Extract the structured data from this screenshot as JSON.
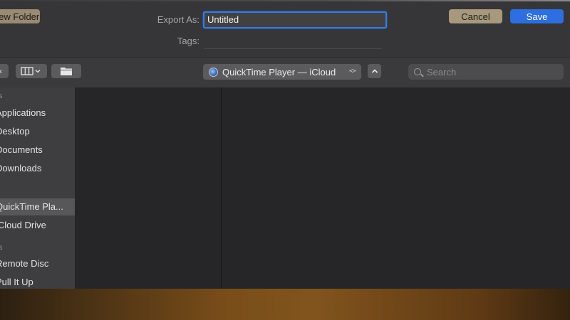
{
  "header": {
    "export_label": "Export As:",
    "export_value": "Untitled",
    "tags_label": "Tags:",
    "tags_value": ""
  },
  "toolbar": {
    "back_icon": "chevron-left-icon",
    "view_icon": "column-view-icon",
    "new_folder_icon": "folder-icon",
    "location": "QuickTime Player — iCloud",
    "location_icon": "icloud-app-icon",
    "expand_icon": "chevron-up-icon",
    "search_placeholder": "Search"
  },
  "sidebar": {
    "sections": [
      {
        "label": "es"
      },
      {
        "label": "ns"
      }
    ],
    "items": [
      {
        "label": "Applications"
      },
      {
        "label": "Desktop"
      },
      {
        "label": "Documents"
      },
      {
        "label": "Downloads"
      },
      {
        "label": "QuickTime Pla...",
        "selected": true
      },
      {
        "label": "iCloud Drive"
      },
      {
        "label": "Remote Disc"
      },
      {
        "label": "Pull It Up"
      }
    ]
  },
  "footer": {
    "new_folder_label": "New Folder",
    "cancel_label": "Cancel",
    "save_label": "Save"
  },
  "colors": {
    "accent": "#2d6ee0",
    "focus_ring": "#3d7bd6"
  }
}
